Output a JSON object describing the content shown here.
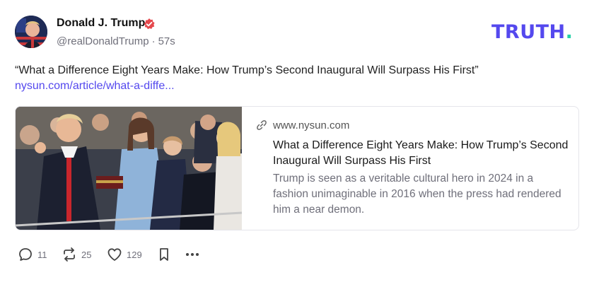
{
  "author": {
    "display_name": "Donald J. Trump",
    "handle": "@realDonaldTrump",
    "time_ago": "57s",
    "verified": true,
    "avatar": "avatar-photo-flag"
  },
  "brand": {
    "logo_text": "TRUTH",
    "logo_dot": ".",
    "accent": "#5448ee",
    "dot_color": "#26d0a8"
  },
  "post": {
    "text": "“What a Difference Eight Years Make: How Trump’s Second Inaugural Will Surpass His First”",
    "link_text": "nysun.com/article/what-a-diffe..."
  },
  "card": {
    "image": "inauguration-oath-photo",
    "domain": "www.nysun.com",
    "title": "What a Difference Eight Years Make: How Trump’s Second Inaugural Will Surpass His First",
    "description": "Trump is seen as a veritable cultural hero in 2024 in a fashion unimaginable in 2016 when the press had rendered him a near demon."
  },
  "actions": {
    "reply": {
      "icon": "reply-bubble-icon",
      "count": "11"
    },
    "retruth": {
      "icon": "retruth-icon",
      "count": "25"
    },
    "like": {
      "icon": "heart-icon",
      "count": "129"
    },
    "bookmark": {
      "icon": "bookmark-icon"
    },
    "more": {
      "icon": "more-dots-icon"
    }
  }
}
